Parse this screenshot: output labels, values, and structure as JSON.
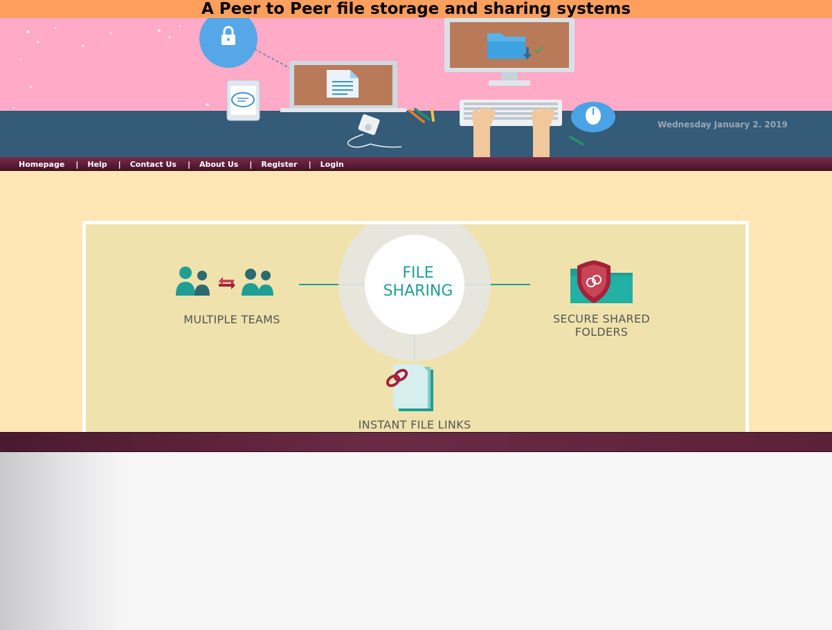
{
  "page_title": "A Peer to Peer file storage and sharing systems",
  "banner": {
    "date": "Wednesday January 2. 2019"
  },
  "nav": {
    "items": [
      {
        "label": "Homepage"
      },
      {
        "label": "Help"
      },
      {
        "label": "Contact Us"
      },
      {
        "label": "About Us"
      },
      {
        "label": "Register"
      },
      {
        "label": "Login"
      }
    ],
    "separator": "|"
  },
  "feature_graphic": {
    "hub_line1": "FILE",
    "hub_line2": "SHARING",
    "left_label": "MULTIPLE TEAMS",
    "right_label_line1": "SECURE SHARED",
    "right_label_line2": "FOLDERS",
    "bottom_label": "INSTANT FILE LINKS"
  },
  "colors": {
    "title_bar": "#ff9f5e",
    "banner_wall": "#ffabc7",
    "banner_desk": "#345b78",
    "nav_bar": "#5c1e34",
    "content_bg": "#ffe6b5",
    "panel_bg": "#efe2ac",
    "teal_accent": "#1f9e95",
    "red_accent": "#a3223a"
  },
  "icons": {
    "lock": "lock-icon",
    "document": "document-icon",
    "chat": "chat-bubble-icon",
    "folder_download": "folder-download-icon",
    "mouse": "mouse-icon",
    "keyboard": "keyboard-icon",
    "team": "team-icon",
    "exchange": "exchange-arrows-icon",
    "shield_folder": "shield-folder-icon",
    "link_file": "file-link-icon"
  }
}
